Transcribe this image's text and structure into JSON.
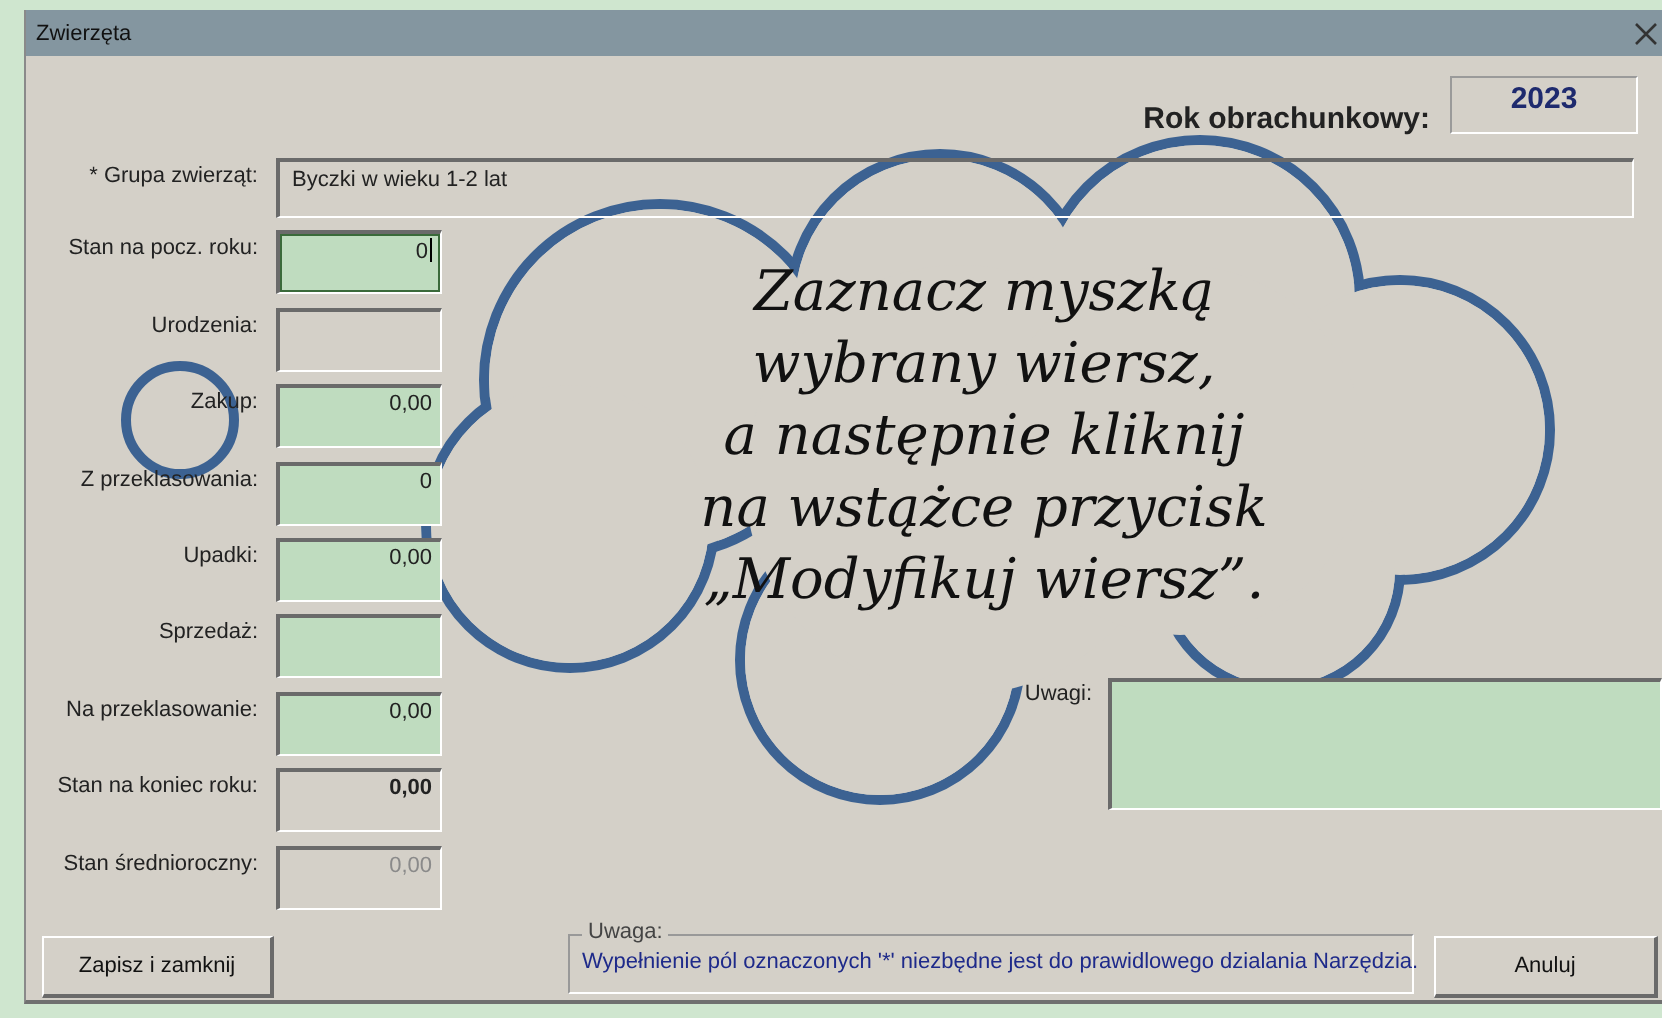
{
  "window": {
    "title": "Zwierzęta"
  },
  "year": {
    "label": "Rok obrachunkowy:",
    "value": "2023"
  },
  "group": {
    "label": "* Grupa zwierząt:",
    "value": "Byczki w wieku 1-2 lat"
  },
  "fields": [
    {
      "label": "Stan na pocz. roku:",
      "value": "0",
      "kind": "editable",
      "focused": true
    },
    {
      "label": "Urodzenia:",
      "kind": "readonly",
      "focused": false
    },
    {
      "label": "Zakup:",
      "value": "0,00",
      "kind": "editable",
      "focused": false
    },
    {
      "label": "Z przeklasowania:",
      "value": "0",
      "kind": "editable",
      "focused": false
    },
    {
      "label": "Upadki:",
      "value": "0,00",
      "kind": "editable",
      "focused": false
    },
    {
      "label": "Sprzedaż:",
      "kind": "editable",
      "focused": false
    },
    {
      "label": "Na przeklasowanie:",
      "value": "0,00",
      "kind": "editable",
      "focused": false
    },
    {
      "label": "Stan na koniec roku:",
      "value": "0,00",
      "kind": "total",
      "focused": false
    },
    {
      "label": "Stan średnioroczny:",
      "value": "0,00",
      "kind": "disabled",
      "focused": false
    }
  ],
  "remarks": {
    "label": "Uwagi:"
  },
  "note": {
    "legend": "Uwaga:",
    "text": "Wypełnienie pól oznaczonych '*' niezbędne jest do prawidlowego dzialania Narzędzia."
  },
  "buttons": {
    "save": "Zapisz i zamknij",
    "cancel": "Anuluj"
  },
  "callout": {
    "lines": [
      "Zaznacz myszką",
      "wybrany wiersz,",
      "a następnie kliknij",
      "na wstążce przycisk",
      "„Modyfikuj wiersz”."
    ]
  }
}
